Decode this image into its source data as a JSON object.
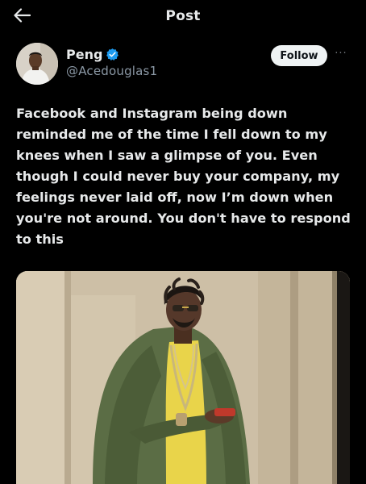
{
  "header": {
    "title": "Post",
    "back_icon": "arrow-left-icon"
  },
  "author": {
    "display_name": "Peng",
    "handle": "@Acedouglas1",
    "verified": true,
    "verified_color": "#1d9bf0",
    "avatar_icon": "avatar"
  },
  "actions": {
    "follow_label": "Follow",
    "more_icon": "more-icon",
    "more_glyph": "···"
  },
  "tweet": {
    "text": "Facebook and Instagram being down\nreminded me of the time I fell down to my\nknees when I saw a glimpse of you. Even\nthough I could never buy your company, my\nfeelings never laid off, now I’m down when\nyou're not around. You don't have to respond\nto this"
  },
  "colors": {
    "background": "#000000",
    "text_primary": "#e7e9ea",
    "text_secondary": "#8b98a5",
    "follow_bg": "#eff3f4"
  }
}
